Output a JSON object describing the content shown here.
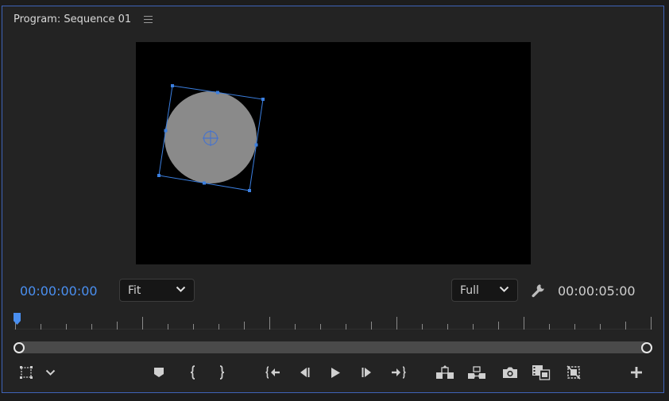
{
  "panel": {
    "title": "Program: Sequence 01",
    "menu_icon": "hamburger-icon"
  },
  "timecodes": {
    "current": "00:00:00:00",
    "duration": "00:00:05:00"
  },
  "zoom": {
    "selected": "Fit"
  },
  "resolution": {
    "selected": "Full"
  },
  "colors": {
    "accent": "#4a8ff0",
    "selection_handles": "#3b7fe0",
    "shape_fill": "#8a8a8a",
    "panel_border": "#3f63b8"
  },
  "controls": {
    "left": [
      "safe-margins-icon",
      "chevron-down-icon"
    ],
    "center": [
      "add-marker-icon",
      "mark-in-icon",
      "mark-out-icon",
      "go-to-in-icon",
      "step-back-icon",
      "play-icon",
      "step-forward-icon",
      "go-to-out-icon"
    ],
    "right": [
      "lift-icon",
      "extract-icon",
      "export-frame-icon",
      "comparison-view-icon",
      "toggle-proxies-icon",
      "add-button-icon"
    ]
  }
}
